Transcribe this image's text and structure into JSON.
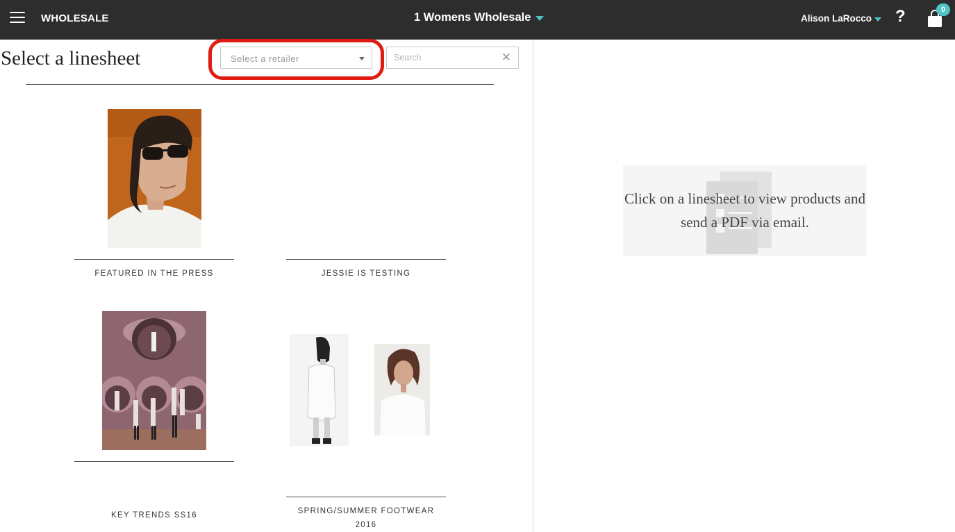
{
  "topbar": {
    "brand": "WHOLESALE",
    "store_name": "1 Womens Wholesale",
    "user_name": "Alison LaRocco",
    "help_label": "?",
    "cart_count": "0"
  },
  "left": {
    "title": "Select a linesheet",
    "retailer_placeholder": "Select a retailer",
    "search_placeholder": "Search",
    "clear_label": "✕",
    "linesheets": [
      {
        "name": "FEATURED IN THE PRESS"
      },
      {
        "name": "JESSIE IS TESTING"
      },
      {
        "name": "KEY TRENDS SS16"
      },
      {
        "name": "SPRING/SUMMER FOOTWEAR 2016"
      }
    ]
  },
  "right": {
    "empty_message": "Click on a linesheet to view products and send a PDF via email."
  },
  "colors": {
    "topbar": "#2d2d2d",
    "accent": "#4fc3c5",
    "highlight": "#e01b12"
  }
}
